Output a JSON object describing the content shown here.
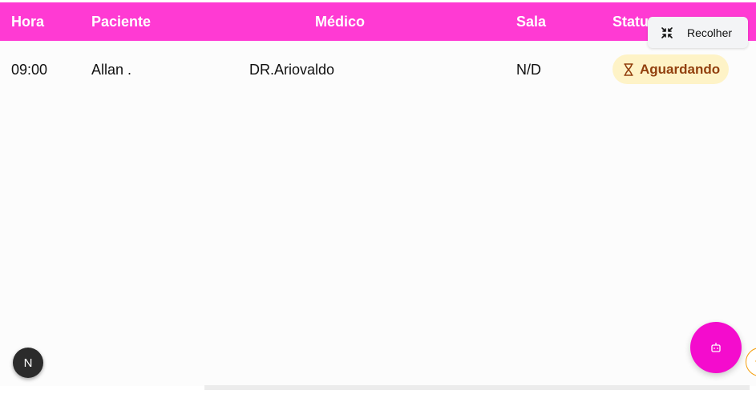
{
  "table": {
    "headers": {
      "hora": "Hora",
      "paciente": "Paciente",
      "medico": "Médico",
      "sala": "Sala",
      "status": "Statu"
    },
    "rows": [
      {
        "hora": "09:00",
        "paciente": "Allan .",
        "medico": "DR.Ariovaldo",
        "sala": "N/D",
        "status": "Aguardando"
      }
    ]
  },
  "collapse_button": {
    "label": "Recolher",
    "icon": "collapse-arrows-icon"
  },
  "next_badge": {
    "label": "N"
  },
  "bot_button": {
    "icon": "robot-icon"
  },
  "scroll_top": {
    "icon": "arrow-up-icon"
  },
  "colors": {
    "header_bg": "#ff3ad3",
    "fab_bg": "#f40ccd",
    "status_bg": "#fef3c7",
    "status_text": "#92400e"
  }
}
